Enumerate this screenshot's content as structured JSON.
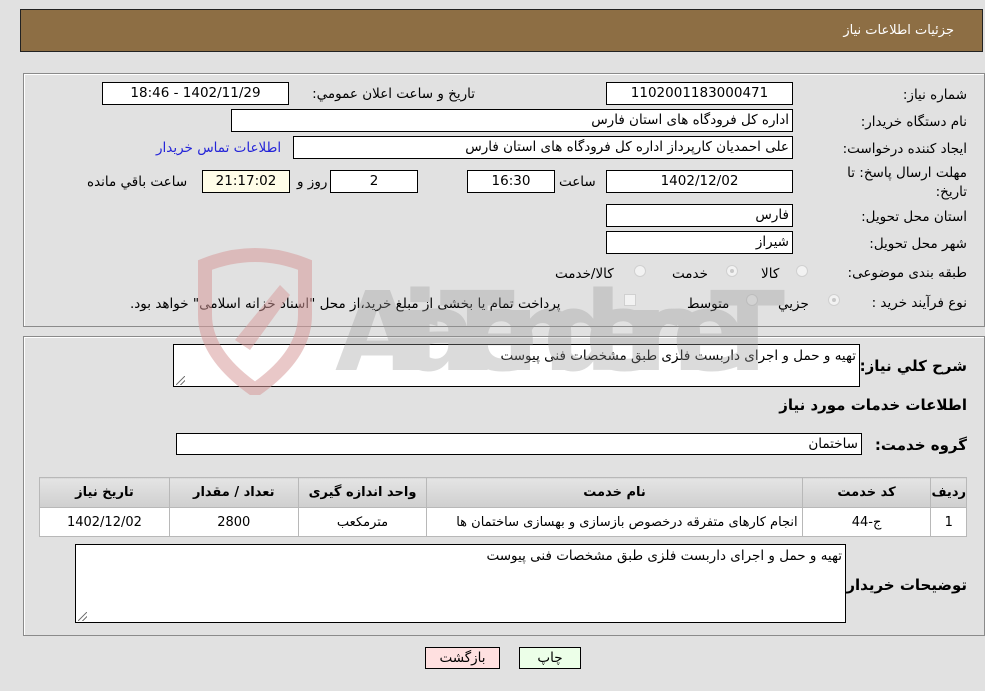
{
  "header": {
    "title": "جزئیات اطلاعات نیاز"
  },
  "form": {
    "need_number": {
      "label": "شماره نیاز:",
      "value": "1102001183000471"
    },
    "announce_datetime": {
      "label": "تاریخ و ساعت اعلان عمومي:",
      "value": "1402/11/29 - 18:46"
    },
    "buyer_org": {
      "label": "نام دستگاه خریدار:",
      "value": "اداره کل فرودگاه های استان فارس"
    },
    "requester": {
      "label": "ایجاد کننده درخواست:",
      "value": "علی  احمدیان کارپرداز اداره کل فرودگاه های استان فارس"
    },
    "buyer_contact_link": "اطلاعات تماس خریدار",
    "deadline": {
      "label": "مهلت ارسال پاسخ: تا تاریخ:",
      "date": "1402/12/02",
      "time_label": "ساعت",
      "time": "16:30",
      "days": "2",
      "days_label": "روز و",
      "remaining": "21:17:02",
      "remaining_label": "ساعت باقي مانده"
    },
    "province": {
      "label": "استان محل تحویل:",
      "value": "فارس"
    },
    "city": {
      "label": "شهر محل تحویل:",
      "value": "شیراز"
    },
    "category": {
      "label": "طبقه بندی موضوعی:",
      "options": [
        {
          "label": "کالا",
          "checked": false
        },
        {
          "label": "خدمت",
          "checked": true
        },
        {
          "label": "کالا/خدمت",
          "checked": false
        }
      ]
    },
    "purchase_process": {
      "label": "نوع فرآیند خرید :",
      "options": [
        {
          "label": "جزیي",
          "checked": true
        },
        {
          "label": "متوسط",
          "checked": false
        }
      ],
      "treasury_note": "پرداخت تمام یا بخشی از مبلغ خرید،از محل \"اسناد خزانه اسلامی\" خواهد بود."
    }
  },
  "details": {
    "general_desc": {
      "label": "شرح کلي نیاز:",
      "value": "تهیه و حمل و اجرای داربست فلزی طبق مشخصات فنی پیوست"
    },
    "services_heading": "اطلاعات خدمات مورد نیاز",
    "service_group": {
      "label": "گروه خدمت:",
      "value": "ساختمان"
    },
    "table": {
      "headers": [
        "ردیف",
        "کد خدمت",
        "نام خدمت",
        "واحد اندازه گیری",
        "تعداد / مقدار",
        "تاریخ نیاز"
      ],
      "rows": [
        [
          "1",
          "ج-44",
          "انجام کارهای متفرقه درخصوص بازسازی و بهسازی ساختمان ها",
          "مترمکعب",
          "2800",
          "1402/12/02"
        ]
      ]
    },
    "buyer_notes": {
      "label": "توضیحات خریدار:",
      "value": "تهیه و حمل و اجرای داربست فلزی طبق مشخصات فنی پیوست"
    }
  },
  "buttons": {
    "print": "چاپ",
    "back": "بازگشت"
  },
  "colors": {
    "header_bg": "#8d6e44",
    "print_bg": "#ecffe8",
    "back_bg": "#ffe0e0",
    "link": "#2424d8",
    "remaining_bg": "#fffde8"
  }
}
